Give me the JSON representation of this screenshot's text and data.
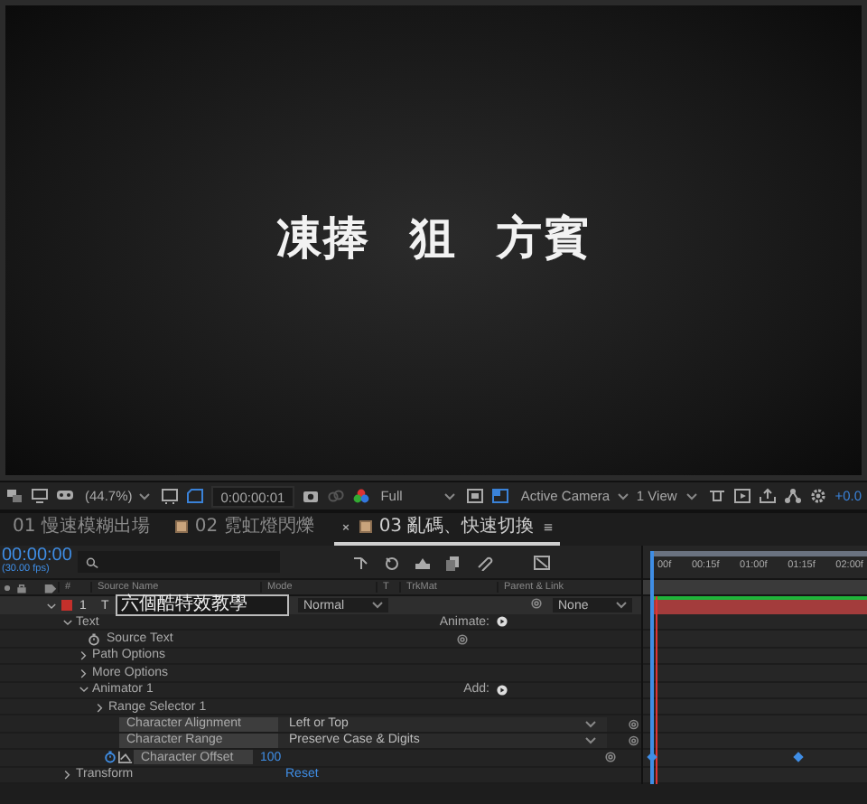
{
  "viewer": {
    "canvas_words": [
      "凍捧",
      "狙",
      "方賓"
    ]
  },
  "viewer_toolbar": {
    "zoom": "(44.7%)",
    "timecode": "0:00:00:01",
    "resolution": "Full",
    "camera": "Active Camera",
    "views": "1 View",
    "exposure": "+0.0"
  },
  "tabs": [
    {
      "label": "01 慢速模糊出場",
      "selected": false
    },
    {
      "label": "02 霓虹燈閃爍",
      "selected": false,
      "color": "#c9a47c"
    },
    {
      "label": "03 亂碼、快速切換",
      "selected": true,
      "color": "#c9a47c"
    }
  ],
  "timeline": {
    "timecode": "00:00:00",
    "fps": "(30.00 fps)",
    "columns": [
      "#",
      "Source Name",
      "Mode",
      "T",
      "TrkMat",
      "Parent & Link"
    ],
    "ruler": [
      "00f",
      "00:15f",
      "01:00f",
      "01:15f",
      "02:00f"
    ],
    "layer": {
      "number": "1",
      "type_mark": "T",
      "name": "六個酷特效教學",
      "mode": "Normal",
      "parent": "None",
      "color": "#c4302b",
      "expanded": true
    },
    "properties": [
      {
        "kind": "group",
        "label": "Text",
        "expanded": true,
        "action": "Animate:",
        "children": [
          {
            "kind": "stopwatch",
            "label": "Source Text",
            "keyframed": false
          },
          {
            "kind": "group",
            "label": "Path Options",
            "expanded": false
          },
          {
            "kind": "group",
            "label": "More Options",
            "expanded": false
          },
          {
            "kind": "group",
            "label": "Animator 1",
            "expanded": true,
            "action": "Add:",
            "children": [
              {
                "kind": "group",
                "label": "Range Selector 1",
                "expanded": false
              },
              {
                "kind": "dropdown",
                "label": "Character Alignment",
                "value": "Left or Top"
              },
              {
                "kind": "dropdown",
                "label": "Character Range",
                "value": "Preserve Case & Digits"
              },
              {
                "kind": "value",
                "label": "Character Offset",
                "value": "100",
                "keyframed": true
              }
            ]
          }
        ]
      },
      {
        "kind": "group",
        "label": "Transform",
        "expanded": false,
        "value": "Reset"
      }
    ]
  }
}
